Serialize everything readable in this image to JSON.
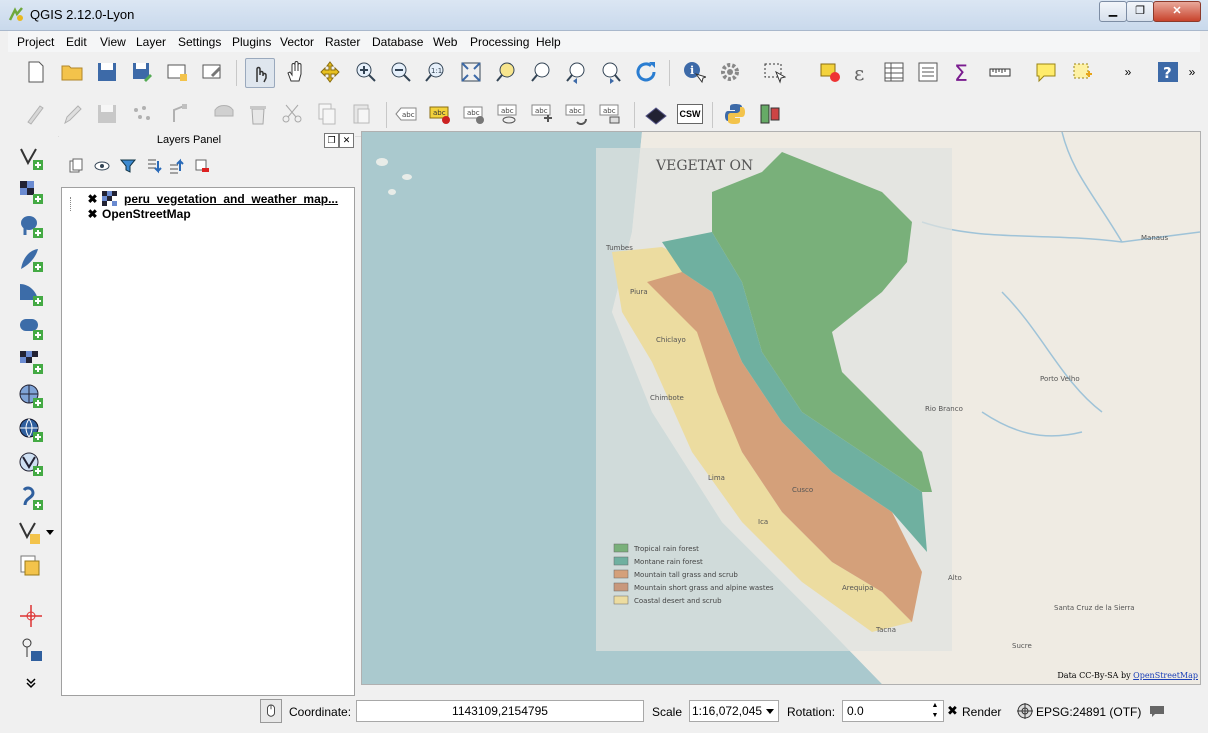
{
  "window": {
    "title": "QGIS 2.12.0-Lyon",
    "close_glyph": "✕"
  },
  "menubar": [
    "Project",
    "Edit",
    "View",
    "Layer",
    "Settings",
    "Plugins",
    "Vector",
    "Raster",
    "Database",
    "Web",
    "Processing",
    "Help"
  ],
  "toolbar_overflow": "»",
  "label_tool_text": "abc",
  "csw_label": "CSW",
  "layers_panel": {
    "title": "Layers Panel",
    "layers": [
      {
        "name": "peru_vegetation_and_weather_map...",
        "checked": true,
        "icon": "raster-layer-icon"
      },
      {
        "name": "OpenStreetMap",
        "checked": true,
        "icon": "none"
      }
    ]
  },
  "map": {
    "legend_title": "VEGETAT ON",
    "legend_items": [
      {
        "label": "Tropical rain forest",
        "color": "#79b07a"
      },
      {
        "label": "Montane rain forest",
        "color": "#6fb0a0"
      },
      {
        "label": "Mountain tall grass and scrub",
        "color": "#d4a07a"
      },
      {
        "label": "Mountain short grass and alpine wastes",
        "color": "#c8987c"
      },
      {
        "label": "Coastal desert and scrub",
        "color": "#ecdca0"
      }
    ],
    "place_labels": [
      "Manaus",
      "Porto Velho",
      "Santa Cruz de la Sierra",
      "Sucre",
      "Lima",
      "Tumbes",
      "Piura",
      "Chiclayo",
      "Chimbote",
      "Rio Branco",
      "Arequipa",
      "Tacna",
      "Cusco",
      "Ica",
      "Alto"
    ],
    "attribution_prefix": "Data CC-By-SA by",
    "attribution_link": "OpenStreetMap"
  },
  "statusbar": {
    "coordinate_label": "Coordinate:",
    "coordinate_value": "1143109,2154795",
    "scale_label": "Scale",
    "scale_value": "1:16,072,045",
    "rotation_label": "Rotation:",
    "rotation_value": "0.0",
    "render_label": "Render",
    "render_checked": true,
    "crs_label": "EPSG:24891 (OTF)"
  }
}
